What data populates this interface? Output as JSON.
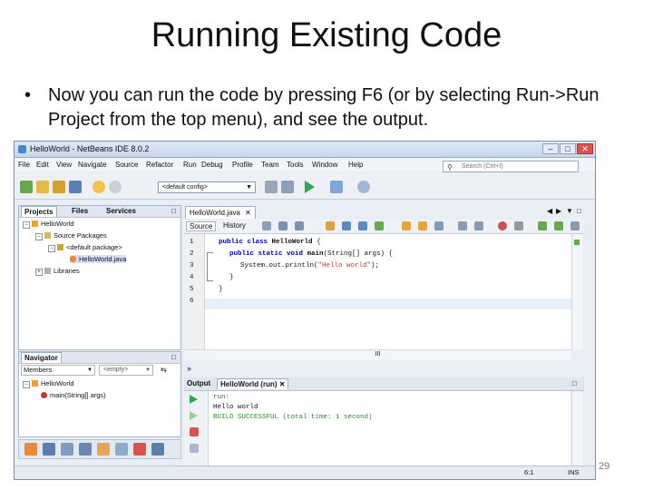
{
  "slide": {
    "title": "Running Existing Code",
    "bullet_symbol": "•",
    "bullet": "Now you can run the code by pressing F6 (or by selecting Run->Run Project from the top menu), and see the output.",
    "page_number": "29"
  },
  "window": {
    "title": "HelloWorld - NetBeans IDE 8.0.2",
    "controls": [
      "–",
      "□",
      "✕"
    ]
  },
  "menu": [
    "File",
    "Edit",
    "View",
    "Navigate",
    "Source",
    "Refactor",
    "Run",
    "Debug",
    "Profile",
    "Team",
    "Tools",
    "Window",
    "Help"
  ],
  "search": {
    "placeholder": "Search (Ctrl+I)"
  },
  "toolbar": {
    "config_value": "<default config>"
  },
  "projects_panel": {
    "tabs": [
      "Projects",
      "Files",
      "Services"
    ],
    "tree": [
      "HelloWorld",
      "Source Packages",
      "<default package>",
      "HelloWorld.java",
      "Libraries"
    ]
  },
  "navigator_panel": {
    "title": "Navigator",
    "members_label": "Members",
    "filter_value": "<empty>",
    "tree": [
      "HelloWorld",
      "main(String[] args)"
    ]
  },
  "editor": {
    "tab_label": "HelloWorld.java",
    "subtabs": [
      "Source",
      "History"
    ],
    "line_numbers": [
      "1",
      "2",
      "3",
      "4",
      "5",
      "6"
    ],
    "scroll_marker": "III"
  },
  "output": {
    "tab_label": "Output",
    "run_tab_label": "HelloWorld (run)",
    "lines": [
      "run:",
      "Hello world",
      "BUILD SUCCESSFUL (total time: 1 second)"
    ]
  },
  "status": {
    "position": "6:1",
    "mode": "INS"
  }
}
